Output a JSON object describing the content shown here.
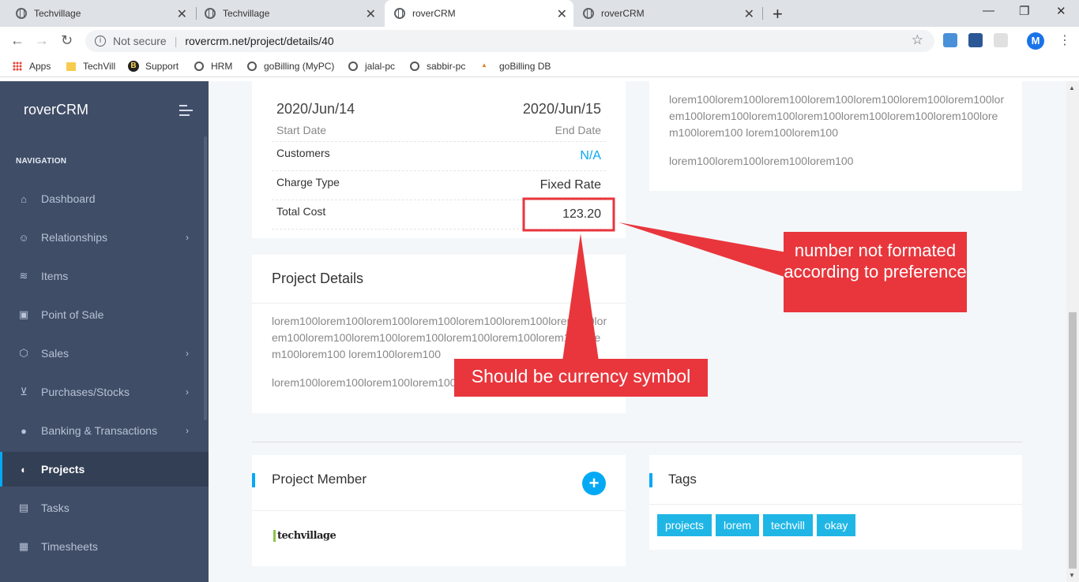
{
  "browser": {
    "tabs": [
      {
        "title": "Techvillage"
      },
      {
        "title": "Techvillage"
      },
      {
        "title": "roverCRM"
      },
      {
        "title": "roverCRM"
      }
    ],
    "address": {
      "security": "Not secure",
      "url": "rovercrm.net/project/details/40"
    },
    "bookmarks": [
      "Apps",
      "TechVill",
      "Support",
      "HRM",
      "goBilling (MyPC)",
      "jalal-pc",
      "sabbir-pc",
      "goBilling DB"
    ],
    "avatar_letter": "M"
  },
  "sidebar": {
    "brand": "roverCRM",
    "nav_label": "NAVIGATION",
    "items": [
      {
        "label": "Dashboard",
        "icon": "home-icon"
      },
      {
        "label": "Relationships",
        "icon": "users-icon"
      },
      {
        "label": "Items",
        "icon": "layers-icon"
      },
      {
        "label": "Point of Sale",
        "icon": "briefcase-icon"
      },
      {
        "label": "Sales",
        "icon": "box-icon"
      },
      {
        "label": "Purchases/Stocks",
        "icon": "cart-icon"
      },
      {
        "label": "Banking & Transactions",
        "icon": "piggy-bank-icon"
      },
      {
        "label": "Projects",
        "icon": "contrast-icon"
      },
      {
        "label": "Tasks",
        "icon": "clipboard-icon"
      },
      {
        "label": "Timesheets",
        "icon": "calendar-icon"
      }
    ]
  },
  "summary": {
    "start_date": "2020/Jun/14",
    "start_label": "Start Date",
    "end_date": "2020/Jun/15",
    "end_label": "End Date",
    "customers_label": "Customers",
    "customers_value": "N/A",
    "charge_type_label": "Charge Type",
    "charge_type_value": "Fixed Rate",
    "total_cost_label": "Total Cost",
    "total_cost_value": "123.20"
  },
  "description_right": {
    "para1": "lorem100lorem100lorem100lorem100lorem100lorem100lorem100lorem100lorem100lorem100lorem100lorem100lorem100lorem100lorem100lorem100 lorem100lorem100",
    "para2": "lorem100lorem100lorem100lorem100"
  },
  "project_details": {
    "title": "Project Details",
    "para1": "lorem100lorem100lorem100lorem100lorem100lorem100lorem100lorem100lorem100lorem100lorem100lorem100lorem100lorem100lorem100lorem100 lorem100lorem100",
    "para2": "lorem100lorem100lorem100lorem100"
  },
  "project_member": {
    "title": "Project Member",
    "logo_text": "techvillage"
  },
  "tags": {
    "title": "Tags",
    "items": [
      "projects",
      "lorem",
      "techvill",
      "okay"
    ]
  },
  "annotations": {
    "format_note": "number not formated according to preference",
    "currency_note": "Should be currency symbol"
  },
  "colors": {
    "accent": "#04a9f5",
    "sidebar": "#3f4d67",
    "callout": "#e8363c",
    "tag": "#1fb6e6"
  }
}
